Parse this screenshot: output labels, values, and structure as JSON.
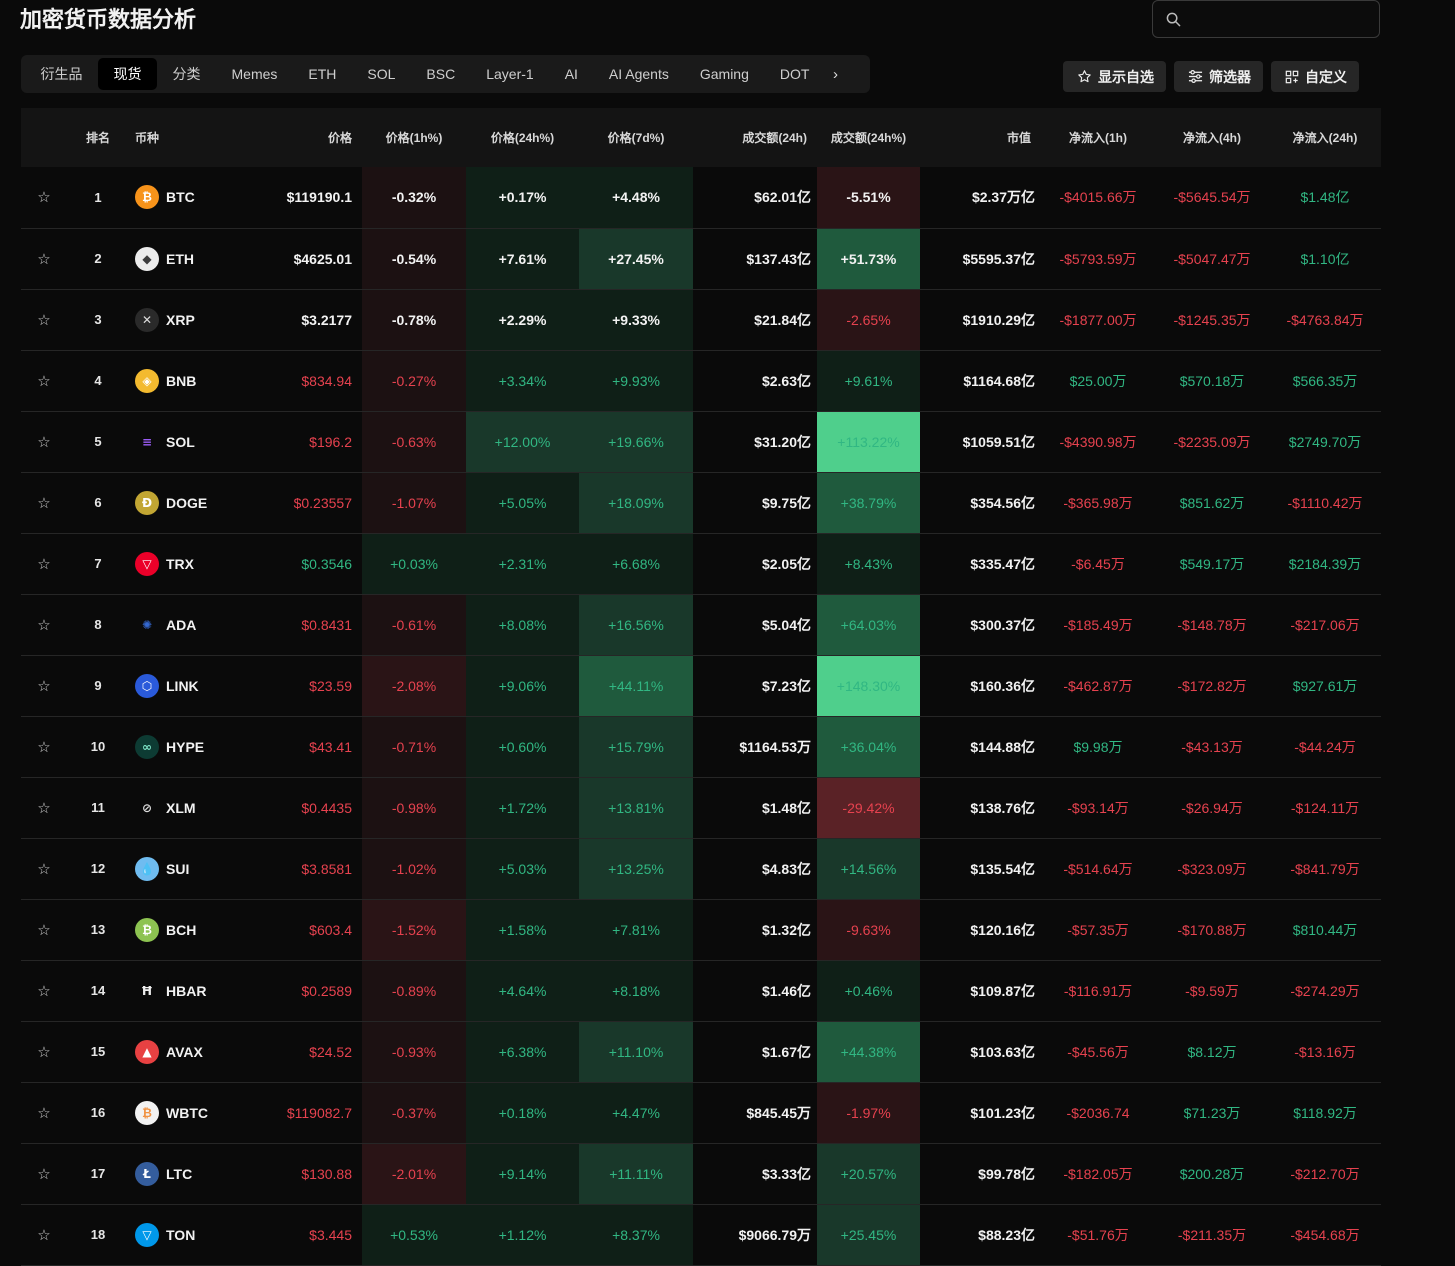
{
  "title": "加密货币数据分析",
  "search": {
    "placeholder": ""
  },
  "tabs": [
    "衍生品",
    "现货",
    "分类",
    "Memes",
    "ETH",
    "SOL",
    "BSC",
    "Layer-1",
    "AI",
    "AI Agents",
    "Gaming",
    "DOT"
  ],
  "active_tab": 1,
  "actions": {
    "watchlist": "显示自选",
    "filter": "筛选器",
    "custom": "自定义"
  },
  "columns": [
    "排名",
    "币种",
    "价格",
    "价格(1h%)",
    "价格(24h%)",
    "价格(7d%)",
    "成交额(24h)",
    "成交额(24h%)",
    "市值",
    "净流入(1h)",
    "净流入(4h)",
    "净流入(24h)"
  ],
  "rows": [
    {
      "rank": "1",
      "symbol": "BTC",
      "icon": "bitcoin-icon",
      "price": "$119190.1",
      "p1h": "-0.32%",
      "p24h": "+0.17%",
      "p7d": "+4.48%",
      "vol": "$62.01亿",
      "vol_pct": "-5.51%",
      "mcap": "$2.37万亿",
      "n1h": "-$4015.66万",
      "n4h": "-$5645.54万",
      "n24h": "$1.48亿"
    },
    {
      "rank": "2",
      "symbol": "ETH",
      "icon": "ethereum-icon",
      "price": "$4625.01",
      "p1h": "-0.54%",
      "p24h": "+7.61%",
      "p7d": "+27.45%",
      "vol": "$137.43亿",
      "vol_pct": "+51.73%",
      "mcap": "$5595.37亿",
      "n1h": "-$5793.59万",
      "n4h": "-$5047.47万",
      "n24h": "$1.10亿"
    },
    {
      "rank": "3",
      "symbol": "XRP",
      "icon": "xrp-icon",
      "price": "$3.2177",
      "p1h": "-0.78%",
      "p24h": "+2.29%",
      "p7d": "+9.33%",
      "vol": "$21.84亿",
      "vol_pct": "-2.65%",
      "mcap": "$1910.29亿",
      "n1h": "-$1877.00万",
      "n4h": "-$1245.35万",
      "n24h": "-$4763.84万"
    },
    {
      "rank": "4",
      "symbol": "BNB",
      "icon": "bnb-icon",
      "price": "$834.94",
      "p1h": "-0.27%",
      "p24h": "+3.34%",
      "p7d": "+9.93%",
      "vol": "$2.63亿",
      "vol_pct": "+9.61%",
      "mcap": "$1164.68亿",
      "n1h": "$25.00万",
      "n4h": "$570.18万",
      "n24h": "$566.35万"
    },
    {
      "rank": "5",
      "symbol": "SOL",
      "icon": "solana-icon",
      "price": "$196.2",
      "p1h": "-0.63%",
      "p24h": "+12.00%",
      "p7d": "+19.66%",
      "vol": "$31.20亿",
      "vol_pct": "+113.22%",
      "mcap": "$1059.51亿",
      "n1h": "-$4390.98万",
      "n4h": "-$2235.09万",
      "n24h": "$2749.70万"
    },
    {
      "rank": "6",
      "symbol": "DOGE",
      "icon": "dogecoin-icon",
      "price": "$0.23557",
      "p1h": "-1.07%",
      "p24h": "+5.05%",
      "p7d": "+18.09%",
      "vol": "$9.75亿",
      "vol_pct": "+38.79%",
      "mcap": "$354.56亿",
      "n1h": "-$365.98万",
      "n4h": "$851.62万",
      "n24h": "-$1110.42万"
    },
    {
      "rank": "7",
      "symbol": "TRX",
      "icon": "tron-icon",
      "price": "$0.3546",
      "p1h": "+0.03%",
      "p24h": "+2.31%",
      "p7d": "+6.68%",
      "vol": "$2.05亿",
      "vol_pct": "+8.43%",
      "mcap": "$335.47亿",
      "n1h": "-$6.45万",
      "n4h": "$549.17万",
      "n24h": "$2184.39万"
    },
    {
      "rank": "8",
      "symbol": "ADA",
      "icon": "cardano-icon",
      "price": "$0.8431",
      "p1h": "-0.61%",
      "p24h": "+8.08%",
      "p7d": "+16.56%",
      "vol": "$5.04亿",
      "vol_pct": "+64.03%",
      "mcap": "$300.37亿",
      "n1h": "-$185.49万",
      "n4h": "-$148.78万",
      "n24h": "-$217.06万"
    },
    {
      "rank": "9",
      "symbol": "LINK",
      "icon": "chainlink-icon",
      "price": "$23.59",
      "p1h": "-2.08%",
      "p24h": "+9.06%",
      "p7d": "+44.11%",
      "vol": "$7.23亿",
      "vol_pct": "+148.30%",
      "mcap": "$160.36亿",
      "n1h": "-$462.87万",
      "n4h": "-$172.82万",
      "n24h": "$927.61万"
    },
    {
      "rank": "10",
      "symbol": "HYPE",
      "icon": "hyperliquid-icon",
      "price": "$43.41",
      "p1h": "-0.71%",
      "p24h": "+0.60%",
      "p7d": "+15.79%",
      "vol": "$1164.53万",
      "vol_pct": "+36.04%",
      "mcap": "$144.88亿",
      "n1h": "$9.98万",
      "n4h": "-$43.13万",
      "n24h": "-$44.24万"
    },
    {
      "rank": "11",
      "symbol": "XLM",
      "icon": "stellar-icon",
      "price": "$0.4435",
      "p1h": "-0.98%",
      "p24h": "+1.72%",
      "p7d": "+13.81%",
      "vol": "$1.48亿",
      "vol_pct": "-29.42%",
      "mcap": "$138.76亿",
      "n1h": "-$93.14万",
      "n4h": "-$26.94万",
      "n24h": "-$124.11万"
    },
    {
      "rank": "12",
      "symbol": "SUI",
      "icon": "sui-icon",
      "price": "$3.8581",
      "p1h": "-1.02%",
      "p24h": "+5.03%",
      "p7d": "+13.25%",
      "vol": "$4.83亿",
      "vol_pct": "+14.56%",
      "mcap": "$135.54亿",
      "n1h": "-$514.64万",
      "n4h": "-$323.09万",
      "n24h": "-$841.79万"
    },
    {
      "rank": "13",
      "symbol": "BCH",
      "icon": "bitcoin-cash-icon",
      "price": "$603.4",
      "p1h": "-1.52%",
      "p24h": "+1.58%",
      "p7d": "+7.81%",
      "vol": "$1.32亿",
      "vol_pct": "-9.63%",
      "mcap": "$120.16亿",
      "n1h": "-$57.35万",
      "n4h": "-$170.88万",
      "n24h": "$810.44万"
    },
    {
      "rank": "14",
      "symbol": "HBAR",
      "icon": "hedera-icon",
      "price": "$0.2589",
      "p1h": "-0.89%",
      "p24h": "+4.64%",
      "p7d": "+8.18%",
      "vol": "$1.46亿",
      "vol_pct": "+0.46%",
      "mcap": "$109.87亿",
      "n1h": "-$116.91万",
      "n4h": "-$9.59万",
      "n24h": "-$274.29万"
    },
    {
      "rank": "15",
      "symbol": "AVAX",
      "icon": "avalanche-icon",
      "price": "$24.52",
      "p1h": "-0.93%",
      "p24h": "+6.38%",
      "p7d": "+11.10%",
      "vol": "$1.67亿",
      "vol_pct": "+44.38%",
      "mcap": "$103.63亿",
      "n1h": "-$45.56万",
      "n4h": "$8.12万",
      "n24h": "-$13.16万"
    },
    {
      "rank": "16",
      "symbol": "WBTC",
      "icon": "wrapped-bitcoin-icon",
      "price": "$119082.7",
      "p1h": "-0.37%",
      "p24h": "+0.18%",
      "p7d": "+4.47%",
      "vol": "$845.45万",
      "vol_pct": "-1.97%",
      "mcap": "$101.23亿",
      "n1h": "-$2036.74",
      "n4h": "$71.23万",
      "n24h": "$118.92万"
    },
    {
      "rank": "17",
      "symbol": "LTC",
      "icon": "litecoin-icon",
      "price": "$130.88",
      "p1h": "-2.01%",
      "p24h": "+9.14%",
      "p7d": "+11.11%",
      "vol": "$3.33亿",
      "vol_pct": "+20.57%",
      "mcap": "$99.78亿",
      "n1h": "-$182.05万",
      "n4h": "$200.28万",
      "n24h": "-$212.70万"
    },
    {
      "rank": "18",
      "symbol": "TON",
      "icon": "toncoin-icon",
      "price": "$3.445",
      "p1h": "+0.53%",
      "p24h": "+1.12%",
      "p7d": "+8.37%",
      "vol": "$9066.79万",
      "vol_pct": "+25.45%",
      "mcap": "$88.23亿",
      "n1h": "-$51.76万",
      "n4h": "-$211.35万",
      "n24h": "-$454.68万"
    }
  ]
}
